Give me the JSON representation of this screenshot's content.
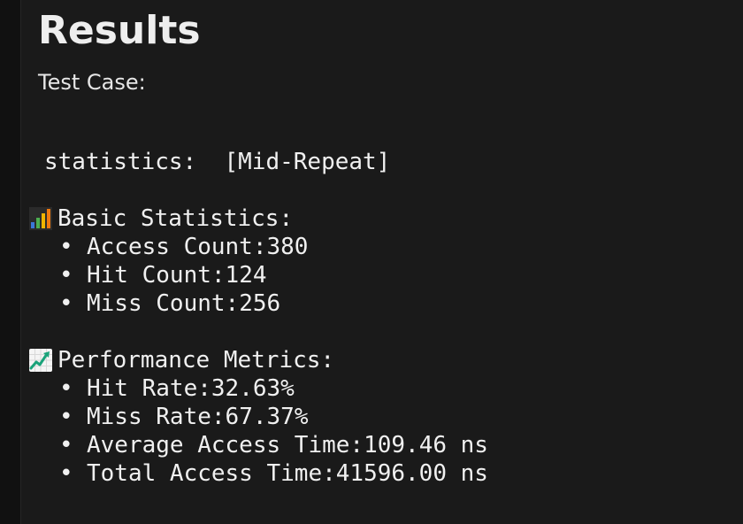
{
  "title": "Results",
  "test_case_label": "Test Case:",
  "statistics": {
    "label": "statistics:",
    "value": "[Mid-Repeat]"
  },
  "bullet": "•",
  "basic_statistics": {
    "icon": "bar-chart-icon",
    "heading": "Basic Statistics:",
    "items": [
      {
        "label": "Access Count:",
        "value": "380"
      },
      {
        "label": "Hit Count:",
        "value": "124"
      },
      {
        "label": "Miss Count:",
        "value": "256"
      }
    ]
  },
  "performance_metrics": {
    "icon": "trending-up-icon",
    "heading": "Performance Metrics:",
    "items": [
      {
        "label": "Hit Rate:",
        "value": "32.63%"
      },
      {
        "label": "Miss Rate:",
        "value": "67.37%"
      },
      {
        "label": "Average Access Time:",
        "value": "109.46 ns"
      },
      {
        "label": "Total Access Time:",
        "value": "41596.00 ns"
      }
    ]
  },
  "colors": {
    "background": "#1a1a1a",
    "text": "#f0f0f0"
  }
}
